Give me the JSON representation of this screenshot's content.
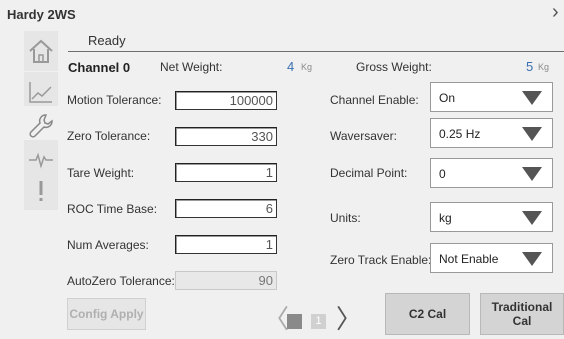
{
  "window": {
    "title": "Hardy 2WS",
    "close_glyph": "›"
  },
  "status": {
    "text": "Ready"
  },
  "nav": [
    {
      "name": "home-icon"
    },
    {
      "name": "trend-icon"
    },
    {
      "name": "wrench-icon"
    },
    {
      "name": "pulse-icon"
    },
    {
      "name": "alert-icon"
    }
  ],
  "channel": {
    "title": "Channel 0",
    "net_label": "Net Weight:",
    "net_value": "4",
    "net_unit": "Kg",
    "gross_label": "Gross Weight:",
    "gross_value": "5",
    "gross_unit": "Kg"
  },
  "fields": {
    "motion_tolerance": {
      "label": "Motion Tolerance:",
      "value": "100000"
    },
    "zero_tolerance": {
      "label": "Zero Tolerance:",
      "value": "330"
    },
    "tare_weight": {
      "label": "Tare Weight:",
      "value": "1"
    },
    "roc_time_base": {
      "label": "ROC Time Base:",
      "value": "6"
    },
    "num_averages": {
      "label": "Num Averages:",
      "value": "1"
    },
    "autozero_tolerance": {
      "label": "AutoZero Tolerance:",
      "value": "90"
    }
  },
  "selects": {
    "channel_enable": {
      "label": "Channel Enable:",
      "value": "On"
    },
    "waversaver": {
      "label": "Waversaver:",
      "value": "0.25 Hz"
    },
    "decimal_point": {
      "label": "Decimal Point:",
      "value": "0"
    },
    "units": {
      "label": "Units:",
      "value": "kg"
    },
    "zero_track_enable": {
      "label": "Zero Track Enable:",
      "value": "Not Enable"
    }
  },
  "buttons": {
    "config_apply": "Config Apply",
    "c2_cal": "C2 Cal",
    "traditional_cal_line1": "Traditional",
    "traditional_cal_line2": "Cal"
  },
  "pager": {
    "prev": "〈",
    "next": "〉",
    "pages": [
      "0",
      "1"
    ],
    "current_page": "0"
  },
  "colors": {
    "accent_value": "#3a6fb0",
    "nav_active": "#8a8a8a",
    "background": "#f0f0f0"
  }
}
